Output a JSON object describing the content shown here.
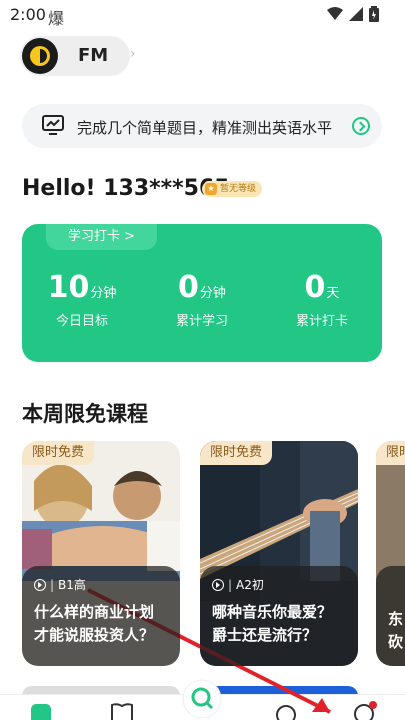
{
  "status_bar": {
    "time": "2:00",
    "notification_glyph": "爆"
  },
  "fm": {
    "label": "FM"
  },
  "test_banner": {
    "text": "完成几个简单题目，精准测出英语水平"
  },
  "greeting": {
    "text": "Hello! 133***565",
    "level_badge": "暂无等级"
  },
  "study_card": {
    "checkin_label": "学习打卡 >",
    "stats": [
      {
        "value": "10",
        "unit": "分钟",
        "caption": "今日目标"
      },
      {
        "value": "0",
        "unit": "分钟",
        "caption": "累计学习"
      },
      {
        "value": "0",
        "unit": "天",
        "caption": "累计打卡"
      }
    ]
  },
  "section": {
    "title": "本周限免课程"
  },
  "courses": [
    {
      "tag": "限时免费",
      "level": "B1高",
      "title": "什么样的商业计划才能说服投资人？"
    },
    {
      "tag": "限时免费",
      "level": "A2初",
      "title": "哪种音乐你最爱？爵士还是流行？"
    },
    {
      "tag": "限时",
      "level": "",
      "title": "东砍"
    }
  ],
  "colors": {
    "accent": "#22c785",
    "arrow": "#e1222a"
  }
}
